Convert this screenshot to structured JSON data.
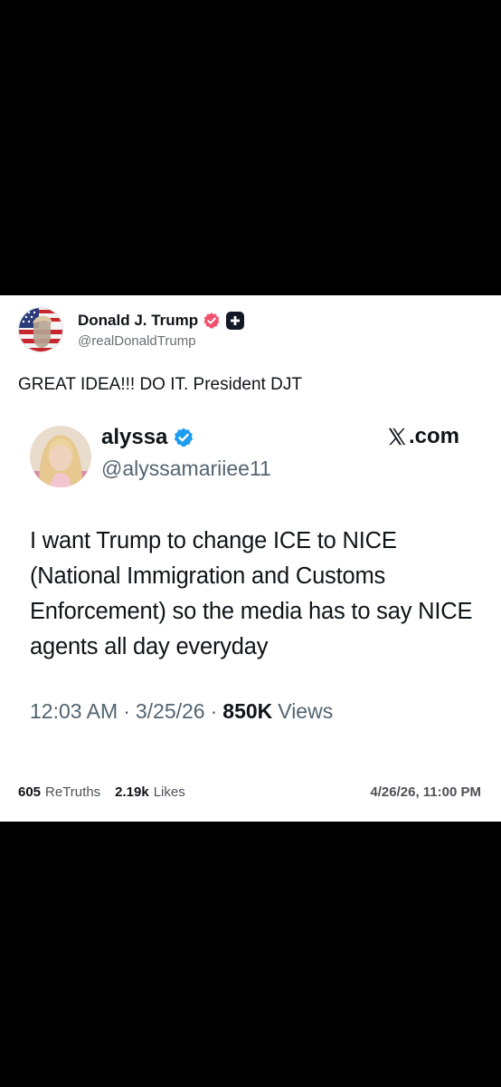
{
  "post": {
    "author_name": "Donald J. Trump",
    "author_handle": "@realDonaldTrump",
    "text": "GREAT IDEA!!! DO IT. President DJT",
    "verified_color": "#f0506e",
    "retruths_count": "605",
    "retruths_label": "ReTruths",
    "likes_count": "2.19k",
    "likes_label": "Likes",
    "date": "4/26/26, 11:00 PM"
  },
  "embedded": {
    "name": "alyssa",
    "handle": "@alyssamariiee11",
    "source": ".com",
    "verified_color": "#1d9bf0",
    "text": "I want Trump to change ICE to NICE (National Immigration and Customs Enforcement) so the media has to say NICE agents all day everyday",
    "time": "12:03 AM",
    "date": "3/25/26",
    "views_count": "850K",
    "views_label": "Views"
  }
}
